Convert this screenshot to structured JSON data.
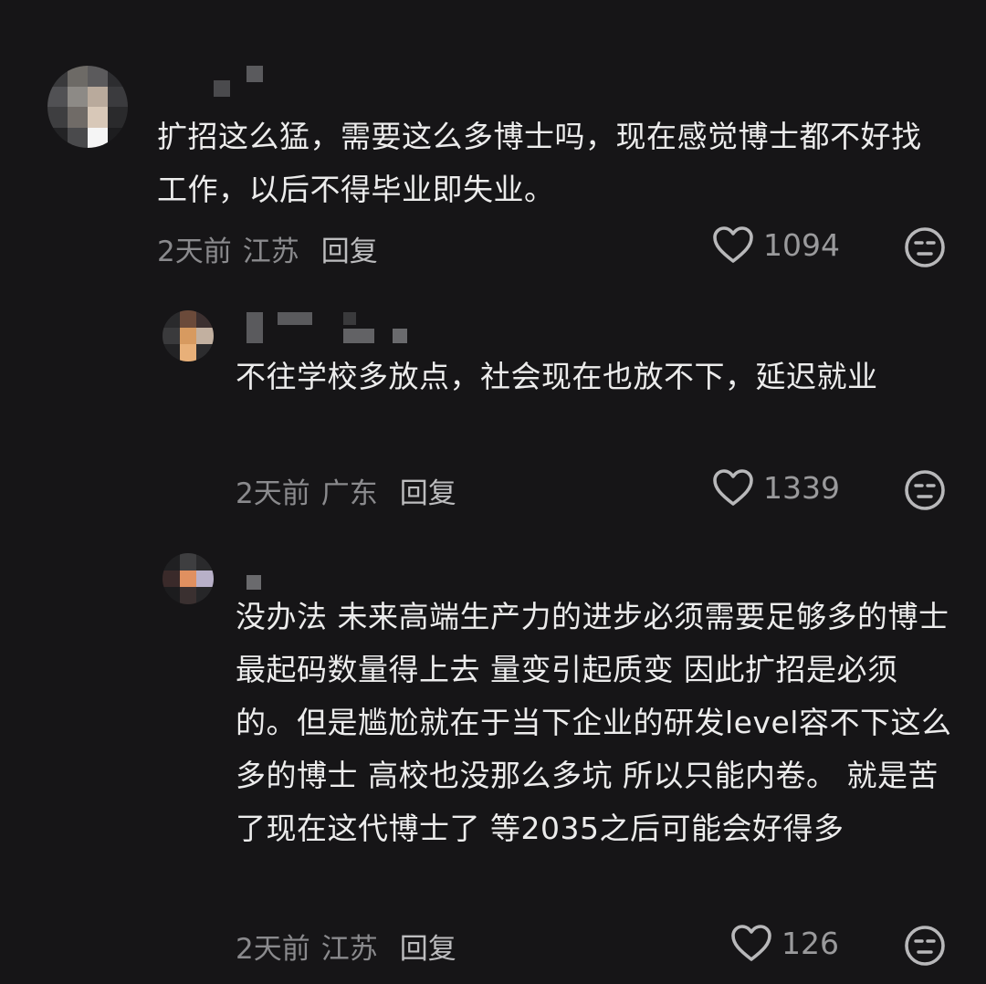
{
  "comments": [
    {
      "text": "扩招这么猛，需要这么多博士吗，现在感觉博士都不好找工作，以后不得毕业即失业。",
      "time": "2天前",
      "region": "江苏",
      "reply": "回复",
      "likes": "1094",
      "icons": {
        "like": "heart-outline-icon",
        "dislike": "unamused-face-icon"
      }
    },
    {
      "text": "不往学校多放点，社会现在也放不下，延迟就业",
      "time": "2天前",
      "region": "广东",
      "reply": "回复",
      "likes": "1339",
      "icons": {
        "like": "heart-outline-icon",
        "dislike": "unamused-face-icon"
      }
    },
    {
      "text": "没办法 未来高端生产力的进步必须需要足够多的博士 最起码数量得上去 量变引起质变 因此扩招是必须的。但是尴尬就在于当下企业的研发level容不下这么多的博士 高校也没那么多坑 所以只能内卷。 就是苦了现在这代博士了 等2035之后可能会好得多",
      "time": "2天前",
      "region": "江苏",
      "reply": "回复",
      "likes": "126",
      "icons": {
        "like": "heart-outline-icon",
        "dislike": "unamused-face-icon"
      }
    }
  ]
}
